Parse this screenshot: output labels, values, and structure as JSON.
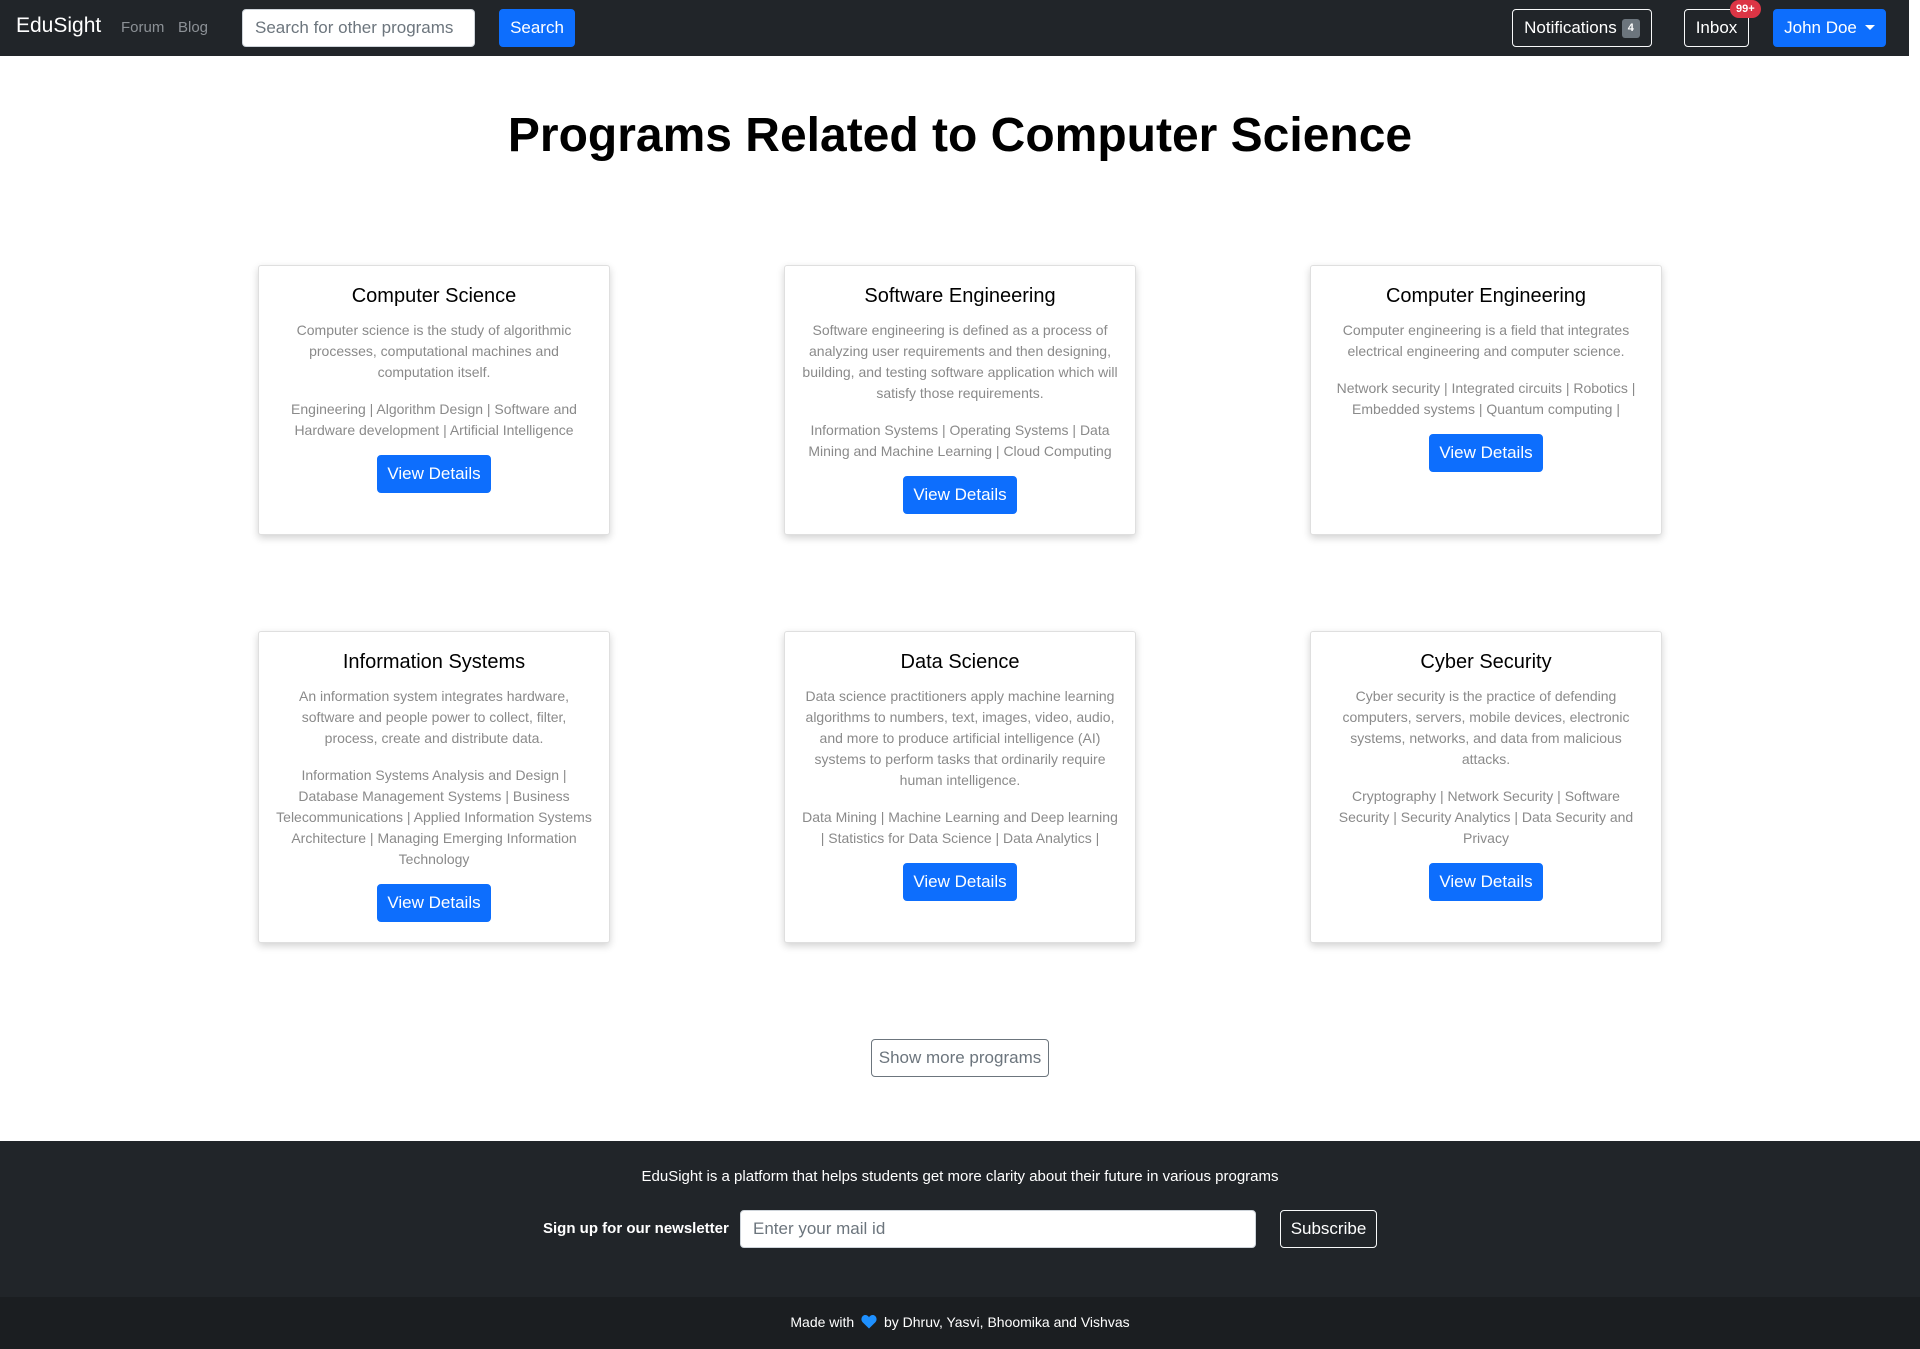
{
  "navbar": {
    "brand": "EduSight",
    "links": [
      "Forum",
      "Blog"
    ],
    "search_placeholder": "Search for other programs",
    "search_button": "Search",
    "notifications_label": "Notifications",
    "notifications_count": "4",
    "inbox_label": "Inbox",
    "inbox_badge": "99+",
    "user_name": "John Doe"
  },
  "page_title": "Programs Related to Computer Science",
  "programs": [
    {
      "title": "Computer Science",
      "description": "Computer science is the study of algorithmic processes, computational machines and computation itself.",
      "topics": "Engineering | Algorithm Design | Software and Hardware development | Artificial Intelligence",
      "button": "View Details"
    },
    {
      "title": "Software Engineering",
      "description": "Software engineering is defined as a process of analyzing user requirements and then designing, building, and testing software application which will satisfy those requirements.",
      "topics": "Information Systems | Operating Systems | Data Mining and Machine Learning | Cloud Computing",
      "button": "View Details"
    },
    {
      "title": "Computer Engineering",
      "description": "Computer engineering is a field that integrates electrical engineering and computer science.",
      "topics": "Network security | Integrated circuits | Robotics | Embedded systems | Quantum computing |",
      "button": "View Details"
    },
    {
      "title": "Information Systems",
      "description": "An information system integrates hardware, software and people power to collect, filter, process, create and distribute data.",
      "topics": "Information Systems Analysis and Design | Database Management Systems | Business Telecommunications | Applied Information Systems Architecture | Managing Emerging Information Technology",
      "button": "View Details"
    },
    {
      "title": "Data Science",
      "description": "Data science practitioners apply machine learning algorithms to numbers, text, images, video, audio, and more to produce artificial intelligence (AI) systems to perform tasks that ordinarily require human intelligence.",
      "topics": "Data Mining | Machine Learning and Deep learning | Statistics for Data Science | Data Analytics |",
      "button": "View Details"
    },
    {
      "title": "Cyber Security",
      "description": "Cyber security is the practice of defending computers, servers, mobile devices, electronic systems, networks, and data from malicious attacks.",
      "topics": "Cryptography | Network Security | Software Security | Security Analytics | Data Security and Privacy",
      "button": "View Details"
    }
  ],
  "show_more": "Show more programs",
  "footer": {
    "description": "EduSight is a platform that helps students get more clarity about their future in various programs",
    "newsletter_label": "Sign up for our newsletter",
    "mail_placeholder": "Enter your mail id",
    "subscribe_button": "Subscribe",
    "made_with_prefix": "Made with",
    "made_with_suffix": "by Dhruv, Yasvi, Bhoomika and Vishvas"
  },
  "colors": {
    "primary": "#0d6efd",
    "dark": "#212529",
    "danger": "#dc3545",
    "heart": "#1e90ff"
  }
}
